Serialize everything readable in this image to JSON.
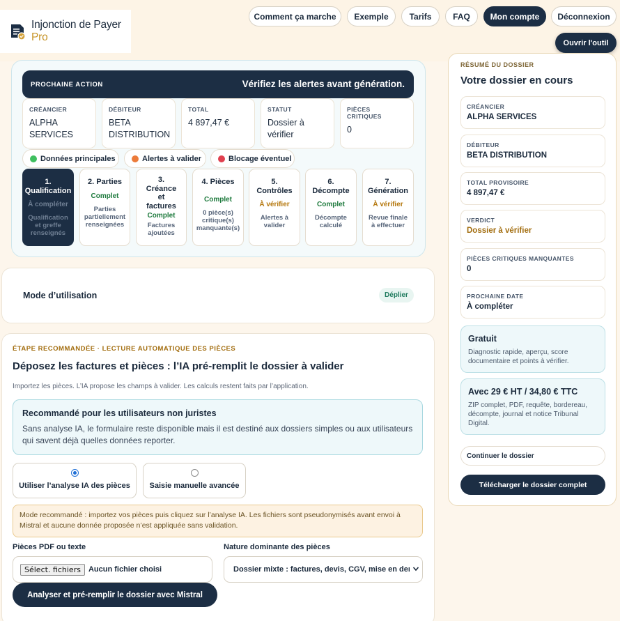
{
  "brand": {
    "name": "Injonction de Payer",
    "suffix": "Pro"
  },
  "nav": [
    {
      "label": "Comment ça marche"
    },
    {
      "label": "Exemple"
    },
    {
      "label": "Tarifs"
    },
    {
      "label": "FAQ"
    },
    {
      "label": "Mon compte"
    },
    {
      "label": "Déconnexion"
    }
  ],
  "open_tool": "Ouvrir l'outil",
  "next_action": {
    "label": "PROCHAINE ACTION",
    "message": "Vérifiez les alertes avant génération."
  },
  "summary_boxes": [
    {
      "key": "CRÉANCIER",
      "value": "ALPHA SERVICES"
    },
    {
      "key": "DÉBITEUR",
      "value": "BETA DISTRIBUTION"
    },
    {
      "key": "TOTAL",
      "value": "4 897,47 €"
    },
    {
      "key": "STATUT",
      "value": "Dossier à vérifier"
    },
    {
      "key": "PIÈCES CRITIQUES",
      "value": "0"
    }
  ],
  "legend": [
    {
      "label": "Données principales",
      "color": "#3fbf5f"
    },
    {
      "label": "Alertes à valider",
      "color": "#ec7b3a"
    },
    {
      "label": "Blocage éventuel",
      "color": "#e0404f"
    }
  ],
  "steps": [
    {
      "title": "1.\nQualification",
      "status": "À compléter",
      "detail": "Qualification\net greffe\nrenseignés"
    },
    {
      "title": "2. Parties",
      "status": "Complet",
      "detail": "Parties\npartiellement\nrenseignées"
    },
    {
      "title": "3.\nCréance\net\nfactures",
      "status": "Complet",
      "detail": "Factures\najoutées"
    },
    {
      "title": "4. Pièces",
      "status": "Complet",
      "detail": "0 pièce(s)\ncritique(s)\nmanquante(s)"
    },
    {
      "title": "5.\nContrôles",
      "status": "À vérifier",
      "detail": "Alertes à\nvalider"
    },
    {
      "title": "6.\nDécompte",
      "status": "Complet",
      "detail": "Décompte\ncalculé"
    },
    {
      "title": "7.\nGénération",
      "status": "À vérifier",
      "detail": "Revue finale\nà effectuer"
    }
  ],
  "mode": {
    "title": "Mode d’utilisation",
    "toggle": "Déplier"
  },
  "upload": {
    "eyebrow": "ÉTAPE RECOMMANDÉE · LECTURE AUTOMATIQUE DES PIÈCES",
    "title": "Déposez les factures et pièces : l’IA pré-remplit le dossier à valider",
    "subtitle": "Importez les pièces. L’IA propose les champs à valider. Les calculs restent faits par l’application.",
    "reco_title": "Recommandé pour les utilisateurs non juristes",
    "reco_body": "Sans analyse IA, le formulaire reste disponible mais il est destiné aux dossiers simples ou aux utilisateurs qui savent déjà quelles données reporter.",
    "option_ai": "Utiliser l’analyse IA des pièces",
    "option_manual": "Saisie manuelle avancée",
    "notice": "Mode recommandé : importez vos pièces puis cliquez sur l’analyse IA. Les fichiers sont pseudonymisés avant envoi à Mistral et aucune donnée proposée n’est appliquée sans validation.",
    "files_label": "Pièces PDF ou texte",
    "file_button": "Sélect. fichiers",
    "file_status": "Aucun fichier choisi",
    "nature_label": "Nature dominante des pièces",
    "nature_value": "Dossier mixte : factures, devis, CGV, mise en demeure",
    "analyze": "Analyser et pré-remplir le dossier avec Mistral"
  },
  "sidebar": {
    "eyebrow": "RÉSUMÉ DU DOSSIER",
    "title": "Votre dossier en cours",
    "items": [
      {
        "key": "CRÉANCIER",
        "value": "ALPHA SERVICES"
      },
      {
        "key": "DÉBITEUR",
        "value": "BETA DISTRIBUTION"
      },
      {
        "key": "TOTAL PROVISOIRE",
        "value": "4 897,47 €"
      },
      {
        "key": "VERDICT",
        "value": "Dossier à vérifier"
      },
      {
        "key": "PIÈCES CRITIQUES MANQUANTES",
        "value": "0"
      },
      {
        "key": "PROCHAINE DATE",
        "value": "À compléter"
      }
    ],
    "plans": [
      {
        "title": "Gratuit",
        "desc": "Diagnostic rapide, aperçu, score documentaire et points à vérifier."
      },
      {
        "title": "Avec 29 € HT / 34,80 € TTC",
        "desc": "ZIP complet, PDF, requête, bordereau, décompte, journal et notice Tribunal Digital."
      }
    ],
    "continue": "Continuer le dossier",
    "download": "Télécharger le dossier complet"
  }
}
